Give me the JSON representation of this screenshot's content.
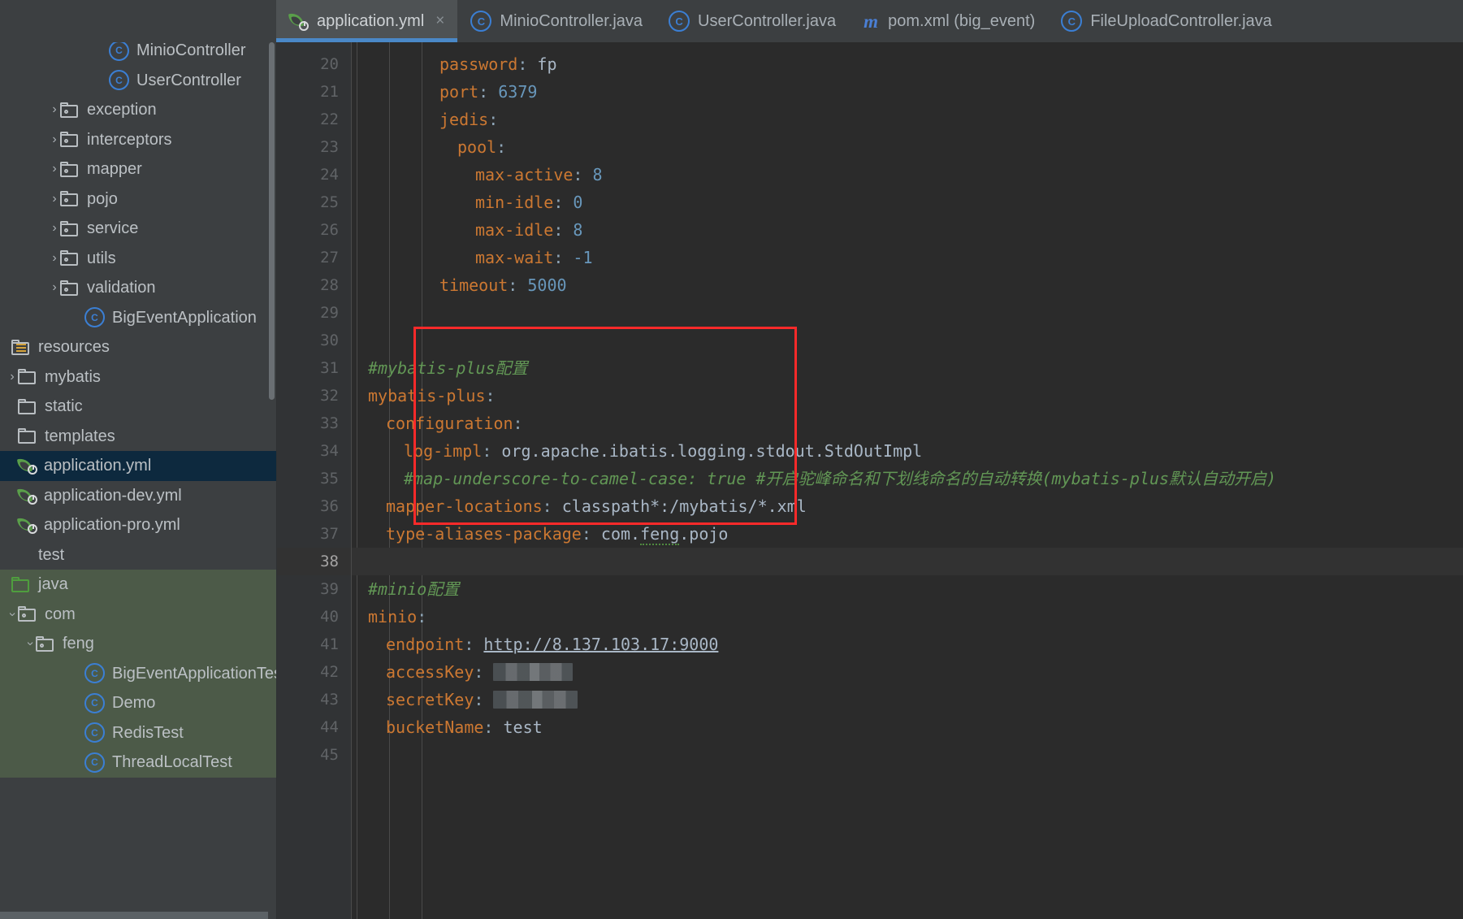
{
  "tabs": [
    {
      "label": "application.yml",
      "icon": "spring-yaml-icon",
      "active": true,
      "close": "×"
    },
    {
      "label": "MinioController.java",
      "icon": "java-class-icon",
      "active": false
    },
    {
      "label": "UserController.java",
      "icon": "java-class-icon",
      "active": false
    },
    {
      "label": "pom.xml (big_event)",
      "icon": "maven-icon",
      "active": false
    },
    {
      "label": "FileUploadController.java",
      "icon": "java-class-icon",
      "active": false
    }
  ],
  "tree": [
    {
      "label": "MinioController",
      "icon": "java-class-icon",
      "indent": 5,
      "arrow": "none"
    },
    {
      "label": "UserController",
      "icon": "java-class-icon",
      "indent": 5,
      "arrow": "none"
    },
    {
      "label": "exception",
      "icon": "package-folder-icon",
      "indent": 3,
      "arrow": "collapsed"
    },
    {
      "label": "interceptors",
      "icon": "package-folder-icon",
      "indent": 3,
      "arrow": "collapsed"
    },
    {
      "label": "mapper",
      "icon": "package-folder-icon",
      "indent": 3,
      "arrow": "collapsed"
    },
    {
      "label": "pojo",
      "icon": "package-folder-icon",
      "indent": 3,
      "arrow": "collapsed"
    },
    {
      "label": "service",
      "icon": "package-folder-icon",
      "indent": 3,
      "arrow": "collapsed"
    },
    {
      "label": "utils",
      "icon": "package-folder-icon",
      "indent": 3,
      "arrow": "collapsed"
    },
    {
      "label": "validation",
      "icon": "package-folder-icon",
      "indent": 3,
      "arrow": "collapsed"
    },
    {
      "label": "BigEventApplication",
      "icon": "spring-class-icon",
      "indent": 4,
      "arrow": "none"
    },
    {
      "label": "resources",
      "icon": "resources-folder-icon",
      "indent": 0,
      "arrow": "none"
    },
    {
      "label": "mybatis",
      "icon": "folder-icon",
      "indent": 1,
      "arrow": "collapsed"
    },
    {
      "label": "static",
      "icon": "folder-icon",
      "indent": 1,
      "arrow": "none"
    },
    {
      "label": "templates",
      "icon": "folder-icon",
      "indent": 1,
      "arrow": "none"
    },
    {
      "label": "application.yml",
      "icon": "spring-yaml-icon",
      "indent": 1,
      "arrow": "none",
      "selected": true
    },
    {
      "label": "application-dev.yml",
      "icon": "spring-yaml-icon",
      "indent": 1,
      "arrow": "none"
    },
    {
      "label": "application-pro.yml",
      "icon": "spring-yaml-icon",
      "indent": 1,
      "arrow": "none"
    },
    {
      "label": "test",
      "icon": "none",
      "indent": 0,
      "arrow": "none"
    },
    {
      "label": "java",
      "icon": "green-folder-icon",
      "indent": 0,
      "arrow": "none",
      "testsrc": true
    },
    {
      "label": "com",
      "icon": "package-folder-icon",
      "indent": 1,
      "arrow": "open",
      "testsrc": true
    },
    {
      "label": "feng",
      "icon": "package-folder-icon",
      "indent": 2,
      "arrow": "open",
      "testsrc": true
    },
    {
      "label": "BigEventApplicationTest",
      "icon": "java-class-icon",
      "indent": 4,
      "arrow": "none",
      "testsrc": true
    },
    {
      "label": "Demo",
      "icon": "java-class-icon",
      "indent": 4,
      "arrow": "none",
      "testsrc": true
    },
    {
      "label": "RedisTest",
      "icon": "java-class-icon",
      "indent": 4,
      "arrow": "none",
      "testsrc": true
    },
    {
      "label": "ThreadLocalTest",
      "icon": "java-class-icon",
      "indent": 4,
      "arrow": "none",
      "testsrc": true
    }
  ],
  "editor": {
    "file": "application.yml",
    "first_line": 20,
    "last_line": 45,
    "current_line": 38,
    "line_numbers": [
      20,
      21,
      22,
      23,
      24,
      25,
      26,
      27,
      28,
      29,
      30,
      31,
      32,
      33,
      34,
      35,
      36,
      37,
      38,
      39,
      40,
      41,
      42,
      43,
      44,
      45
    ],
    "lines": [
      {
        "n": 20,
        "indent": 4,
        "key": "password",
        "value": "fp",
        "kind": "string"
      },
      {
        "n": 21,
        "indent": 4,
        "key": "port",
        "value": "6379",
        "kind": "number"
      },
      {
        "n": 22,
        "indent": 4,
        "key": "jedis",
        "value": "",
        "kind": "map"
      },
      {
        "n": 23,
        "indent": 5,
        "key": "pool",
        "value": "",
        "kind": "map"
      },
      {
        "n": 24,
        "indent": 6,
        "key": "max-active",
        "value": "8",
        "kind": "number"
      },
      {
        "n": 25,
        "indent": 6,
        "key": "min-idle",
        "value": "0",
        "kind": "number"
      },
      {
        "n": 26,
        "indent": 6,
        "key": "max-idle",
        "value": "8",
        "kind": "number"
      },
      {
        "n": 27,
        "indent": 6,
        "key": "max-wait",
        "value": "-1",
        "kind": "number"
      },
      {
        "n": 28,
        "indent": 4,
        "key": "timeout",
        "value": "5000",
        "kind": "number"
      },
      {
        "n": 29,
        "indent": 0,
        "kind": "blank"
      },
      {
        "n": 30,
        "indent": 0,
        "kind": "blank"
      },
      {
        "n": 31,
        "indent": 0,
        "kind": "comment",
        "text": "#mybatis-plus配置"
      },
      {
        "n": 32,
        "indent": 0,
        "key": "mybatis-plus",
        "value": "",
        "kind": "map"
      },
      {
        "n": 33,
        "indent": 1,
        "key": "configuration",
        "value": "",
        "kind": "map"
      },
      {
        "n": 34,
        "indent": 2,
        "key": "log-impl",
        "value": "org.apache.ibatis.logging.stdout.StdOutImpl",
        "kind": "string"
      },
      {
        "n": 35,
        "indent": 2,
        "kind": "comment",
        "text": "#map-underscore-to-camel-case: true #开启驼峰命名和下划线命名的自动转换(mybatis-plus默认自动开启)"
      },
      {
        "n": 36,
        "indent": 1,
        "key": "mapper-locations",
        "value": "classpath*:/mybatis/*.xml",
        "kind": "string"
      },
      {
        "n": 37,
        "indent": 1,
        "key": "type-aliases-package",
        "value": "com.feng.pojo",
        "kind": "string",
        "warn": "feng"
      },
      {
        "n": 38,
        "indent": 0,
        "kind": "blank",
        "current": true
      },
      {
        "n": 39,
        "indent": 0,
        "kind": "comment",
        "text": "#minio配置"
      },
      {
        "n": 40,
        "indent": 0,
        "key": "minio",
        "value": "",
        "kind": "map"
      },
      {
        "n": 41,
        "indent": 1,
        "key": "endpoint",
        "value": "http://8.137.103.17:9000",
        "kind": "url"
      },
      {
        "n": 42,
        "indent": 1,
        "key": "accessKey",
        "value": "",
        "kind": "redacted"
      },
      {
        "n": 43,
        "indent": 1,
        "key": "secretKey",
        "value": "",
        "kind": "redacted"
      },
      {
        "n": 44,
        "indent": 1,
        "key": "bucketName",
        "value": "test",
        "kind": "string"
      },
      {
        "n": 45,
        "indent": 0,
        "kind": "blank"
      }
    ],
    "annotation": {
      "type": "red-rectangle",
      "color": "#fb2a2a",
      "covers_lines": "39-45"
    }
  },
  "colors": {
    "editor_bg": "#2b2b2b",
    "gutter_bg": "#313335",
    "sidebar_bg": "#3c3f41",
    "selection_bg": "#0d293e",
    "test_source_bg": "#4c5a48",
    "key_orange": "#cc7832",
    "number_blue": "#6897bb",
    "comment_green": "#629755",
    "text_gray": "#a9b7c6",
    "tab_underline": "#4a88c7",
    "annotation_red": "#fb2a2a"
  }
}
